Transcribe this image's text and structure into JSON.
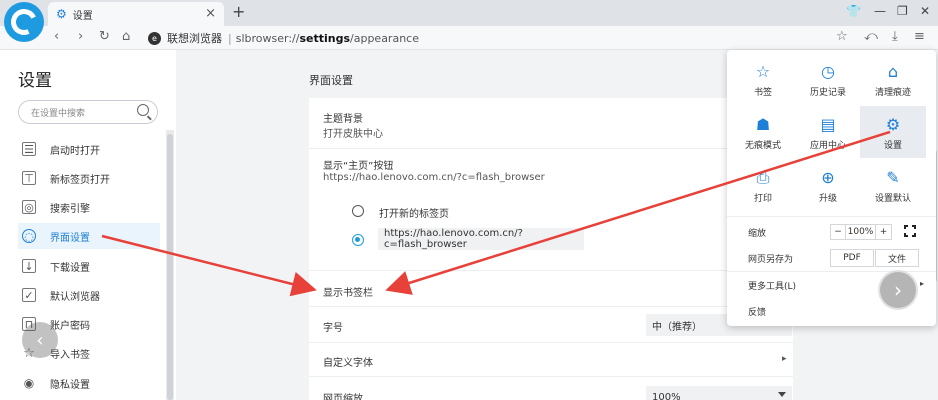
{
  "tab": {
    "title": "设置"
  },
  "address": {
    "site_name": "联想浏览器",
    "separator": "|",
    "url_prefix": "slbrowser://",
    "url_bold": "settings",
    "url_suffix": "/appearance"
  },
  "sidebar": {
    "title": "设置",
    "search_placeholder": "在设置中搜索",
    "items": [
      {
        "label": "启动时打开",
        "icon": "startup-icon"
      },
      {
        "label": "新标签页打开",
        "icon": "newtab-icon"
      },
      {
        "label": "搜索引擎",
        "icon": "search-engine-icon"
      },
      {
        "label": "界面设置",
        "icon": "palette-icon",
        "active": true
      },
      {
        "label": "下载设置",
        "icon": "download-icon"
      },
      {
        "label": "默认浏览器",
        "icon": "default-browser-icon"
      },
      {
        "label": "账户密码",
        "icon": "lock-icon"
      },
      {
        "label": "导入书签",
        "icon": "star-icon"
      },
      {
        "label": "隐私设置",
        "icon": "eye-icon"
      }
    ]
  },
  "main": {
    "section_title": "界面设置",
    "theme": {
      "label": "主题背景",
      "sub": "打开皮肤中心"
    },
    "home_button": {
      "label": "显示“主页”按钮",
      "sub": "https://hao.lenovo.com.cn/?c=flash_browser"
    },
    "radio_new_tab": "打开新的标签页",
    "radio_url_value": "https://hao.lenovo.com.cn/?c=flash_browser",
    "bookmark_bar": "显示书签栏",
    "font_size": {
      "label": "字号",
      "value": "中（推荐）"
    },
    "custom_font": "自定义字体",
    "page_zoom": {
      "label": "网页缩放",
      "value": "100%"
    }
  },
  "popup": {
    "grid": [
      {
        "label": "书签",
        "icon": "star-icon"
      },
      {
        "label": "历史记录",
        "icon": "clock-icon"
      },
      {
        "label": "清理痕迹",
        "icon": "broom-icon"
      },
      {
        "label": "无痕模式",
        "icon": "incognito-icon"
      },
      {
        "label": "应用中心",
        "icon": "store-icon"
      },
      {
        "label": "设置",
        "icon": "gear-icon",
        "selected": true
      },
      {
        "label": "打印",
        "icon": "printer-icon"
      },
      {
        "label": "升级",
        "icon": "upgrade-icon"
      },
      {
        "label": "设置默认",
        "icon": "default-icon"
      }
    ],
    "zoom_label": "缩放",
    "zoom_minus": "−",
    "zoom_value": "100%",
    "zoom_plus": "+",
    "save_as_label": "网页另存为",
    "pdf": "PDF",
    "file": "文件",
    "more_tools": "更多工具(L)",
    "feedback": "反馈"
  },
  "colors": {
    "accent": "#1e7fd6",
    "arrow": "#e8413a"
  }
}
